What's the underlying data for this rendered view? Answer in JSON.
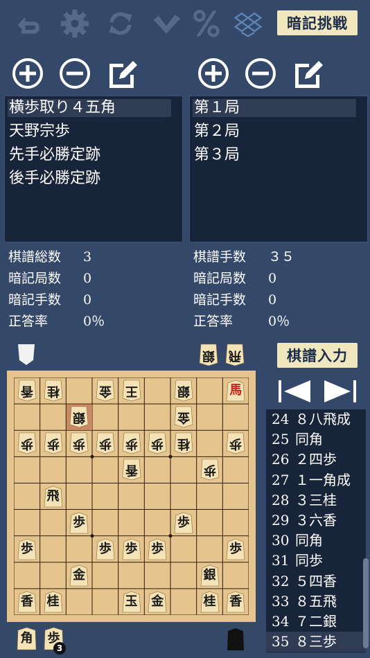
{
  "toolbar": {
    "icons": [
      "undo-icon",
      "gear-icon",
      "refresh-icon",
      "check-icon",
      "percent-icon",
      "dropbox-icon"
    ],
    "memorize_label": "暗記挑戦"
  },
  "left_list": {
    "items": [
      {
        "label": "横歩取り４五角",
        "selected": true
      },
      {
        "label": "天野宗歩",
        "selected": false
      },
      {
        "label": "先手必勝定跡",
        "selected": false
      },
      {
        "label": "後手必勝定跡",
        "selected": false
      }
    ]
  },
  "right_list": {
    "items": [
      {
        "label": "第１局",
        "selected": true
      },
      {
        "label": "第２局",
        "selected": false
      },
      {
        "label": "第３局",
        "selected": false
      }
    ]
  },
  "left_stats": [
    {
      "label": "棋譜総数",
      "value": "3"
    },
    {
      "label": "暗記局数",
      "value": "0"
    },
    {
      "label": "暗記手数",
      "value": "0"
    },
    {
      "label": "正答率",
      "value": "0％"
    }
  ],
  "right_stats": [
    {
      "label": "棋譜手数",
      "value": "３５"
    },
    {
      "label": "暗記局数",
      "value": "0"
    },
    {
      "label": "暗記手数",
      "value": "0"
    },
    {
      "label": "正答率",
      "value": "0％"
    }
  ],
  "input_button_label": "棋譜入力",
  "gote_hand": [
    "銀",
    "飛"
  ],
  "sente_hand": [
    {
      "piece": "角",
      "count": ""
    },
    {
      "piece": "歩",
      "count": "3"
    }
  ],
  "board": {
    "highlight": [
      1,
      2
    ],
    "pieces": [
      {
        "row": 0,
        "col": 0,
        "p": "香",
        "side": "gote"
      },
      {
        "row": 0,
        "col": 1,
        "p": "桂",
        "side": "gote"
      },
      {
        "row": 0,
        "col": 3,
        "p": "金",
        "side": "gote"
      },
      {
        "row": 0,
        "col": 4,
        "p": "王",
        "side": "gote"
      },
      {
        "row": 0,
        "col": 6,
        "p": "銀",
        "side": "gote"
      },
      {
        "row": 0,
        "col": 8,
        "p": "馬",
        "side": "sente",
        "red": true
      },
      {
        "row": 1,
        "col": 2,
        "p": "銀",
        "side": "gote"
      },
      {
        "row": 1,
        "col": 6,
        "p": "金",
        "side": "gote"
      },
      {
        "row": 2,
        "col": 0,
        "p": "歩",
        "side": "gote"
      },
      {
        "row": 2,
        "col": 1,
        "p": "歩",
        "side": "gote"
      },
      {
        "row": 2,
        "col": 2,
        "p": "歩",
        "side": "gote"
      },
      {
        "row": 2,
        "col": 3,
        "p": "歩",
        "side": "gote"
      },
      {
        "row": 2,
        "col": 4,
        "p": "歩",
        "side": "gote"
      },
      {
        "row": 2,
        "col": 5,
        "p": "歩",
        "side": "gote"
      },
      {
        "row": 2,
        "col": 6,
        "p": "桂",
        "side": "gote"
      },
      {
        "row": 2,
        "col": 8,
        "p": "歩",
        "side": "gote"
      },
      {
        "row": 3,
        "col": 4,
        "p": "香",
        "side": "gote"
      },
      {
        "row": 3,
        "col": 7,
        "p": "歩",
        "side": "gote"
      },
      {
        "row": 4,
        "col": 1,
        "p": "飛",
        "side": "sente"
      },
      {
        "row": 5,
        "col": 2,
        "p": "歩",
        "side": "sente"
      },
      {
        "row": 5,
        "col": 6,
        "p": "歩",
        "side": "sente"
      },
      {
        "row": 6,
        "col": 0,
        "p": "歩",
        "side": "sente"
      },
      {
        "row": 6,
        "col": 3,
        "p": "歩",
        "side": "sente"
      },
      {
        "row": 6,
        "col": 4,
        "p": "歩",
        "side": "sente"
      },
      {
        "row": 6,
        "col": 5,
        "p": "歩",
        "side": "sente"
      },
      {
        "row": 6,
        "col": 8,
        "p": "歩",
        "side": "sente"
      },
      {
        "row": 7,
        "col": 2,
        "p": "金",
        "side": "sente"
      },
      {
        "row": 7,
        "col": 7,
        "p": "銀",
        "side": "sente"
      },
      {
        "row": 8,
        "col": 0,
        "p": "香",
        "side": "sente"
      },
      {
        "row": 8,
        "col": 1,
        "p": "桂",
        "side": "sente"
      },
      {
        "row": 8,
        "col": 4,
        "p": "玉",
        "side": "sente"
      },
      {
        "row": 8,
        "col": 5,
        "p": "金",
        "side": "sente"
      },
      {
        "row": 8,
        "col": 7,
        "p": "桂",
        "side": "sente"
      },
      {
        "row": 8,
        "col": 8,
        "p": "香",
        "side": "sente"
      }
    ]
  },
  "moves": [
    {
      "num": "24",
      "text": "８八飛成"
    },
    {
      "num": "25",
      "text": "同角"
    },
    {
      "num": "26",
      "text": "２四歩"
    },
    {
      "num": "27",
      "text": "１一角成"
    },
    {
      "num": "28",
      "text": "３三桂"
    },
    {
      "num": "29",
      "text": "３六香"
    },
    {
      "num": "30",
      "text": "同角"
    },
    {
      "num": "31",
      "text": "同歩"
    },
    {
      "num": "32",
      "text": "５四香"
    },
    {
      "num": "33",
      "text": "８五飛"
    },
    {
      "num": "34",
      "text": "７二銀"
    },
    {
      "num": "35",
      "text": "８三歩"
    }
  ],
  "selected_move": "35",
  "colors": {
    "background": "#34486a",
    "panel": "#182439",
    "button": "#f1e7bf",
    "board": "#e5c48d",
    "icon": "#56698a"
  }
}
